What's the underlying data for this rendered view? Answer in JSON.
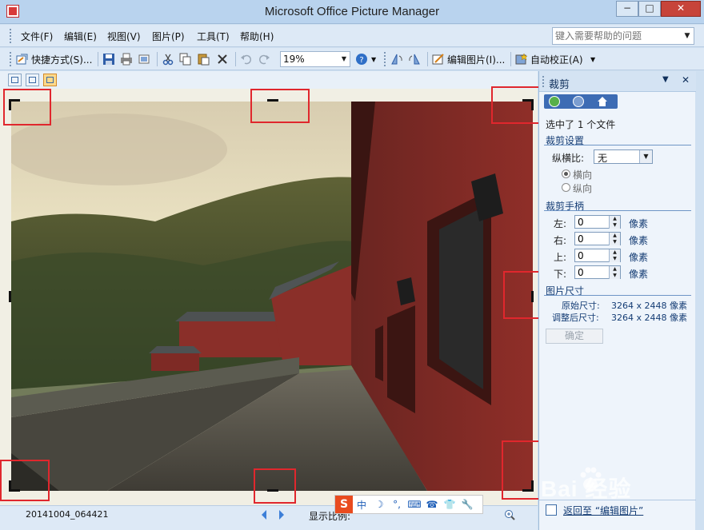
{
  "window": {
    "title": "Microsoft Office Picture Manager",
    "min_glyph": "−",
    "max_glyph": "□",
    "close_glyph": "✕"
  },
  "menu": {
    "items": [
      "文件(F)",
      "编辑(E)",
      "视图(V)",
      "图片(P)",
      "工具(T)",
      "帮助(H)"
    ],
    "help_placeholder": "键入需要帮助的问题"
  },
  "toolbar": {
    "shortcuts_label": "快捷方式(S)...",
    "zoom_value": "19%",
    "edit_picture_label": "编辑图片(I)...",
    "auto_correct_label": "自动校正(A)"
  },
  "status": {
    "filename": "20141004_064421",
    "zoom_label": "显示比例:"
  },
  "ime": {
    "logo": "S",
    "items": [
      "中",
      "☽",
      "°,",
      "⌨",
      "☎",
      "👕",
      "🔧"
    ]
  },
  "pane": {
    "title": "裁剪",
    "selection_text": "选中了 1 个文件",
    "crop_settings_heading": "裁剪设置",
    "aspect_label": "纵横比:",
    "aspect_value": "无",
    "orientation_landscape": "横向",
    "orientation_portrait": "纵向",
    "orientation_selected": "横向",
    "handles_heading": "裁剪手柄",
    "handles": [
      {
        "label": "左:",
        "value": "0",
        "unit": "像素"
      },
      {
        "label": "右:",
        "value": "0",
        "unit": "像素"
      },
      {
        "label": "上:",
        "value": "0",
        "unit": "像素"
      },
      {
        "label": "下:",
        "value": "0",
        "unit": "像素"
      }
    ],
    "size_heading": "图片尺寸",
    "original_size_label": "原始尺寸:",
    "original_size_value": "3264 x 2448 像素",
    "adjusted_size_label": "调整后尺寸:",
    "adjusted_size_value": "3264 x 2448 像素",
    "ok_label": "确定",
    "return_link": "返回至 “编辑图片”"
  },
  "watermark": {
    "text": "Bai 经验"
  },
  "colors": {
    "crop_marker": "#e0272d",
    "pane_accent": "#3d6cb4",
    "wall_red": "#8f2e28"
  }
}
